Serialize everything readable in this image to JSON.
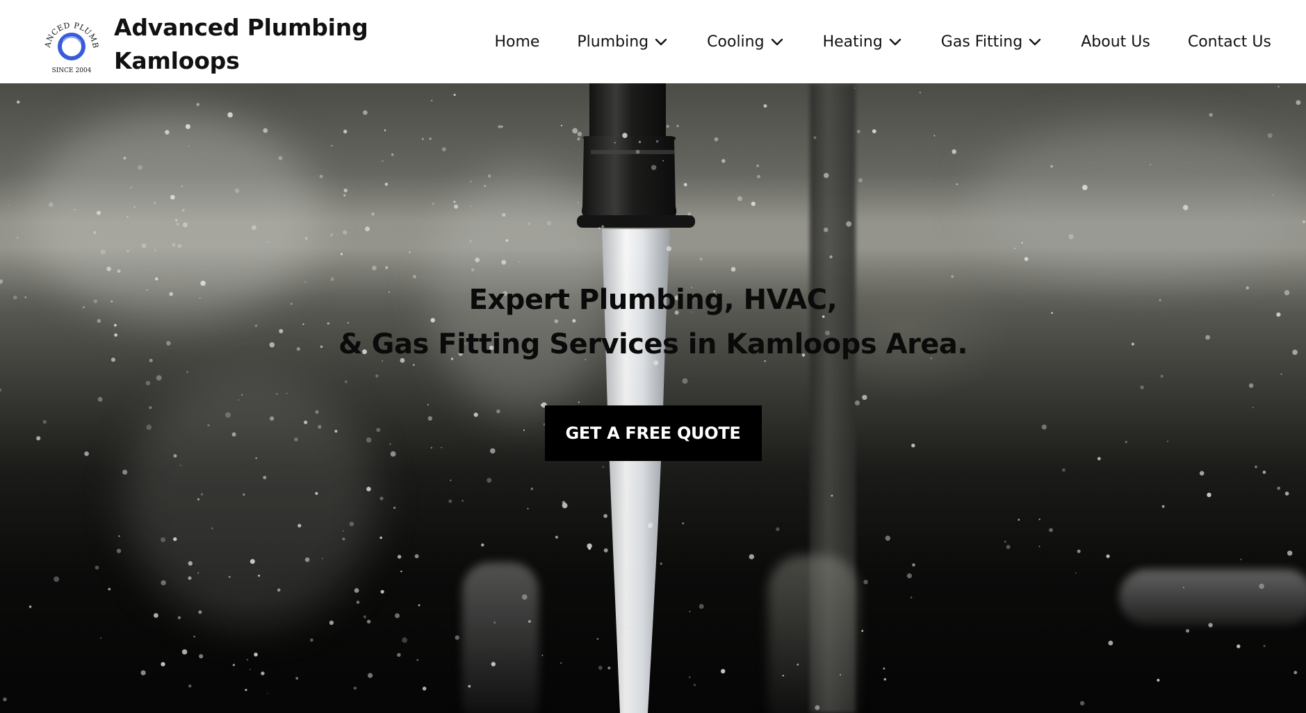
{
  "header": {
    "logo": {
      "arc_text": "ADVANCED PLUMBING",
      "since_text": "SINCE 2004",
      "accent_color": "#3a5bd9"
    },
    "brand_line1": "Advanced Plumbing",
    "brand_line2": "Kamloops",
    "nav": [
      {
        "label": "Home",
        "has_dropdown": false
      },
      {
        "label": "Plumbing",
        "has_dropdown": true
      },
      {
        "label": "Cooling",
        "has_dropdown": true
      },
      {
        "label": "Heating",
        "has_dropdown": true
      },
      {
        "label": "Gas Fitting",
        "has_dropdown": true
      },
      {
        "label": "About Us",
        "has_dropdown": false
      },
      {
        "label": "Contact Us",
        "has_dropdown": false
      }
    ]
  },
  "hero": {
    "headline_line1": "Expert Plumbing, HVAC,",
    "headline_line2": "& Gas Fitting Services in Kamloops Area.",
    "cta_label": "GET A FREE QUOTE",
    "background_image": "water-faucet-photo"
  }
}
